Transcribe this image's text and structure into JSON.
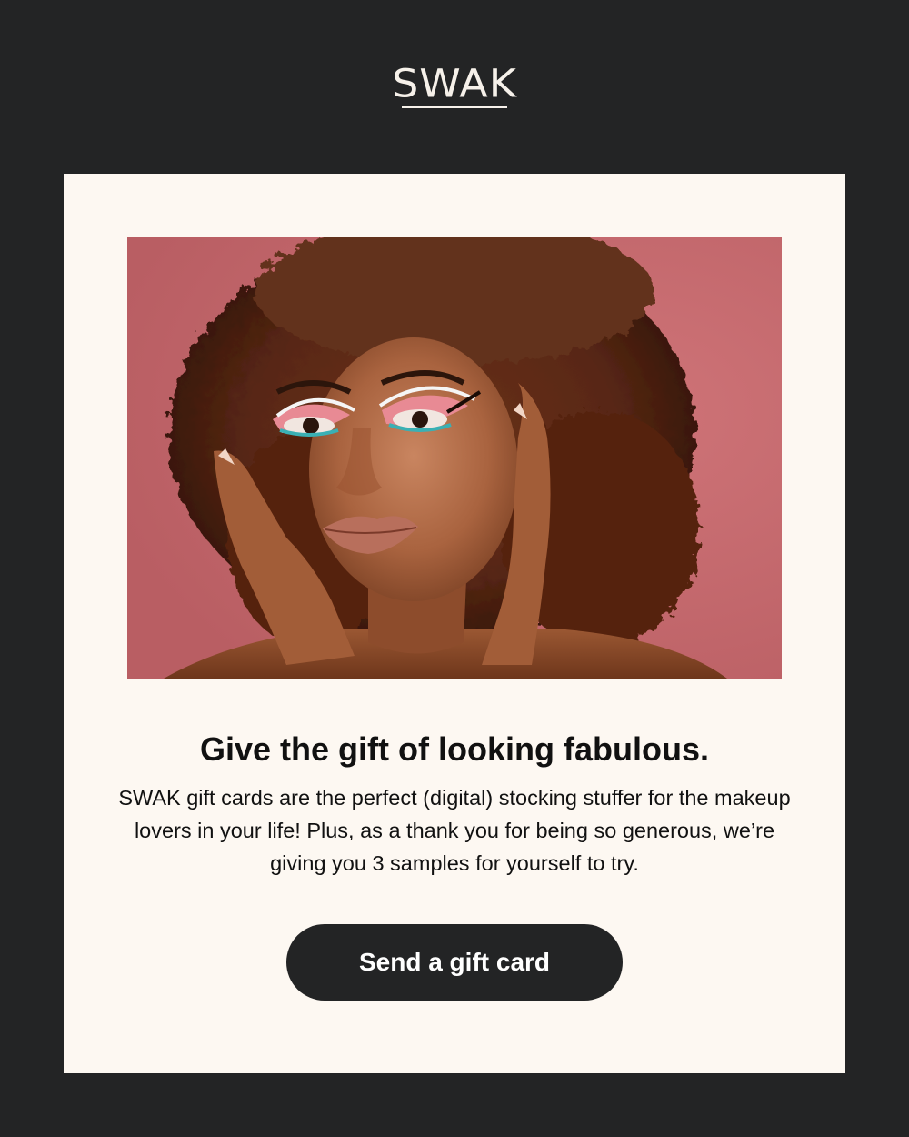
{
  "brand": {
    "logo_text": "SWAK",
    "colors": {
      "background": "#232425",
      "card": "#fdf8f2",
      "text": "#111111",
      "button": "#232425",
      "button_text": "#ffffff",
      "hero_backdrop": "#c6676b"
    }
  },
  "hero": {
    "alt": "Model with voluminous curly hair and colorful eye makeup"
  },
  "headline": {
    "prefix": "Give the gift of looking ",
    "emphasis": "fabulous",
    "suffix": "."
  },
  "body": {
    "text": "SWAK gift cards are the perfect (digital) stocking stuffer for the makeup lovers in your life! Plus, as a thank you for being so generous, we’re giving you 3 samples for yourself to try."
  },
  "cta": {
    "label": "Send a gift card"
  }
}
